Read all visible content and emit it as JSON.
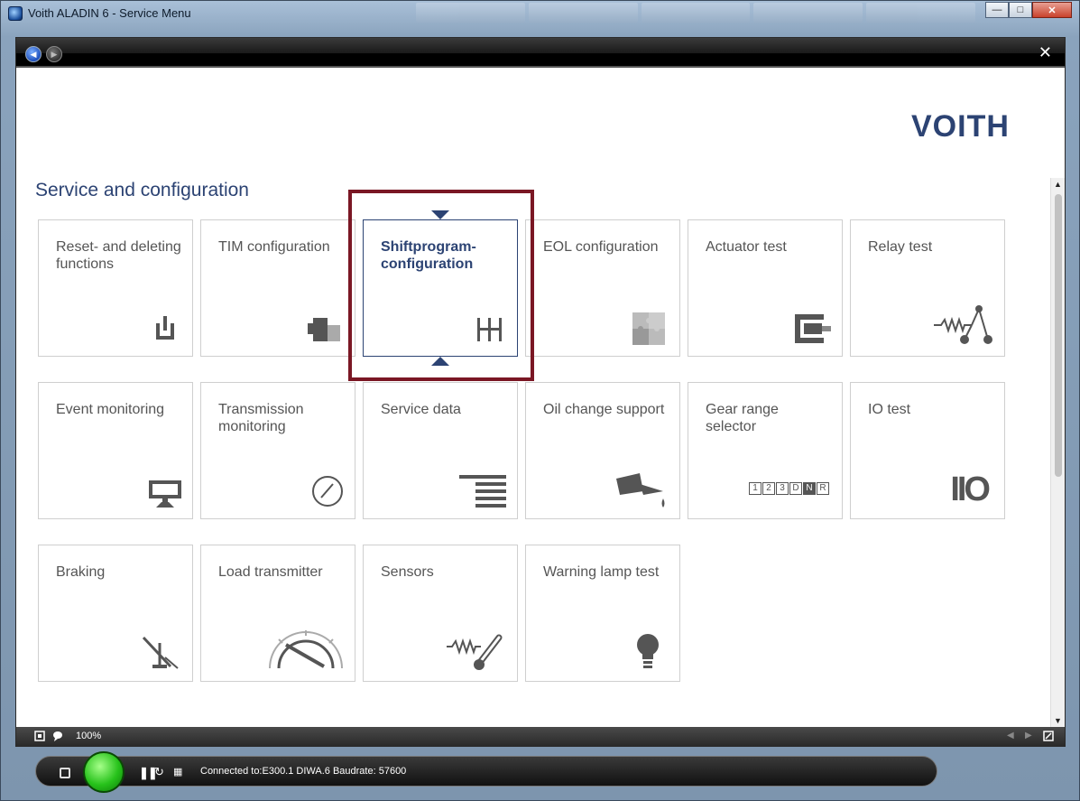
{
  "window": {
    "title": "Voith ALADIN 6 - Service Menu"
  },
  "header": {
    "logo": "VOITH"
  },
  "page": {
    "title": "Service and configuration"
  },
  "tiles": [
    {
      "label": "Reset- and deleting functions",
      "icon": "power-icon"
    },
    {
      "label": "TIM configuration",
      "icon": "tim-block-icon"
    },
    {
      "label": "Shiftprogram-configuration",
      "icon": "shift-gate-icon",
      "selected": true
    },
    {
      "label": "EOL configuration",
      "icon": "puzzle-icon"
    },
    {
      "label": "Actuator test",
      "icon": "actuator-icon"
    },
    {
      "label": "Relay test",
      "icon": "relay-icon"
    },
    {
      "label": "Event monitoring",
      "icon": "monitor-icon"
    },
    {
      "label": "Transmission monitoring",
      "icon": "gauge-icon"
    },
    {
      "label": "Service data",
      "icon": "lines-icon"
    },
    {
      "label": "Oil change support",
      "icon": "oil-can-icon"
    },
    {
      "label": "Gear range selector",
      "icon": "gear-range-icon",
      "gear_keys": [
        "1",
        "2",
        "3",
        "D",
        "N",
        "R"
      ]
    },
    {
      "label": "IO test",
      "icon": "io-icon",
      "io_text": "IIO"
    },
    {
      "label": "Braking",
      "icon": "brake-lever-icon"
    },
    {
      "label": "Load transmitter",
      "icon": "load-gauge-icon"
    },
    {
      "label": "Sensors",
      "icon": "thermometer-icon"
    },
    {
      "label": "Warning lamp test",
      "icon": "lamp-icon"
    }
  ],
  "status": {
    "zoom": "100%"
  },
  "dock": {
    "connection": "Connected to:E300.1  DIWA.6 Baudrate: 57600"
  },
  "colors": {
    "brand": "#2c4373",
    "highlight": "#7a1724",
    "go": "#27c21b"
  }
}
